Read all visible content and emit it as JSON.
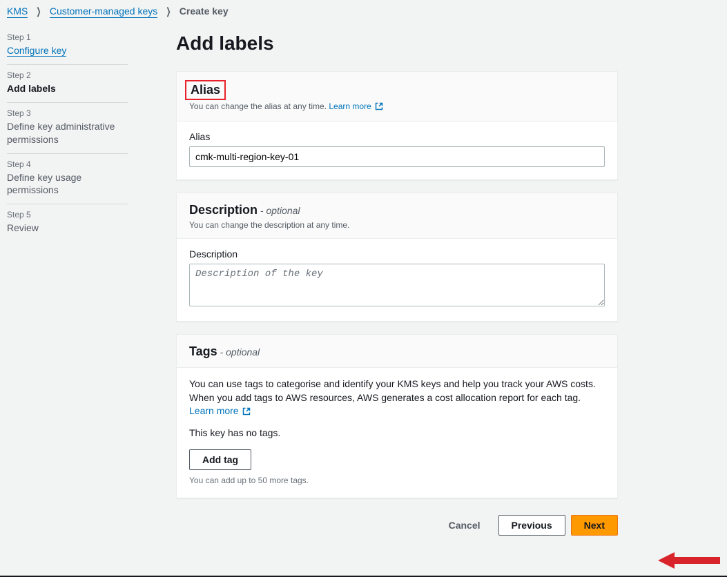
{
  "breadcrumb": {
    "root": "KMS",
    "parent": "Customer-managed keys",
    "current": "Create key"
  },
  "sidebar": {
    "steps": [
      {
        "num": "Step 1",
        "label": "Configure key",
        "state": "link"
      },
      {
        "num": "Step 2",
        "label": "Add labels",
        "state": "active"
      },
      {
        "num": "Step 3",
        "label": "Define key administrative permissions",
        "state": "normal"
      },
      {
        "num": "Step 4",
        "label": "Define key usage permissions",
        "state": "normal"
      },
      {
        "num": "Step 5",
        "label": "Review",
        "state": "normal"
      }
    ]
  },
  "page": {
    "title": "Add labels"
  },
  "alias": {
    "heading": "Alias",
    "sub": "You can change the alias at any time.",
    "learn_more": "Learn more",
    "field_label": "Alias",
    "value": "cmk-multi-region-key-01"
  },
  "description": {
    "heading": "Description",
    "optional": "- optional",
    "sub": "You can change the description at any time.",
    "field_label": "Description",
    "placeholder": "Description of the key",
    "value": ""
  },
  "tags": {
    "heading": "Tags",
    "optional": "- optional",
    "body_text": "You can use tags to categorise and identify your KMS keys and help you track your AWS costs. When you add tags to AWS resources, AWS generates a cost allocation report for each tag.",
    "learn_more": "Learn more",
    "no_tags": "This key has no tags.",
    "add_tag_label": "Add tag",
    "limit": "You can add up to 50 more tags."
  },
  "buttons": {
    "cancel": "Cancel",
    "previous": "Previous",
    "next": "Next"
  }
}
